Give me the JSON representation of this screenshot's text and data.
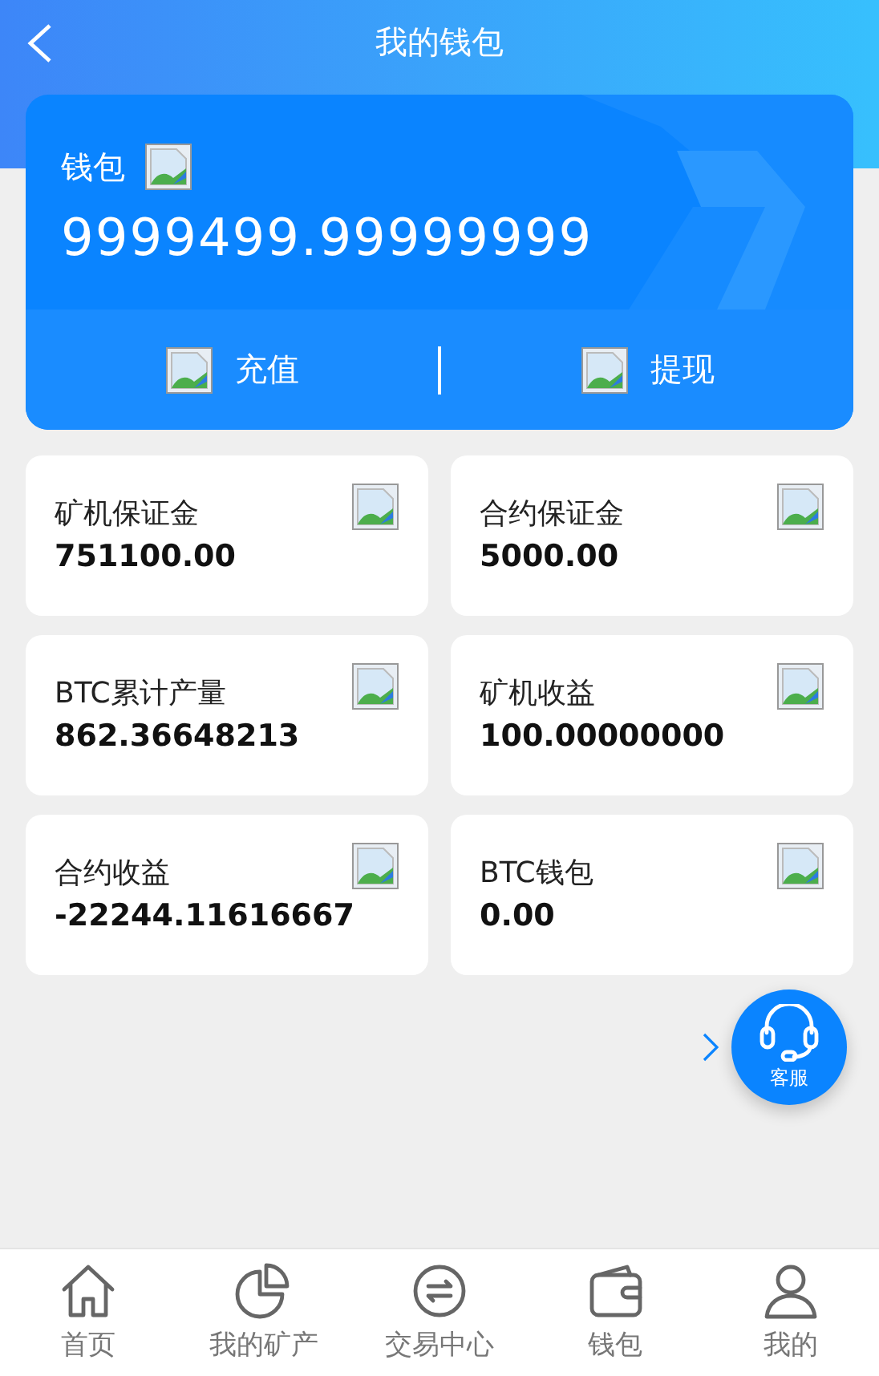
{
  "header": {
    "title": "我的钱包"
  },
  "wallet": {
    "label": "钱包",
    "balance": "9999499.99999999",
    "actions": [
      {
        "label": "充值"
      },
      {
        "label": "提现"
      }
    ]
  },
  "stats": [
    {
      "label": "矿机保证金",
      "value": "751100.00"
    },
    {
      "label": "合约保证金",
      "value": "5000.00"
    },
    {
      "label": "BTC累计产量",
      "value": "862.36648213"
    },
    {
      "label": "矿机收益",
      "value": "100.00000000"
    },
    {
      "label": "合约收益",
      "value": "-22244.11616667"
    },
    {
      "label": "BTC钱包",
      "value": "0.00"
    }
  ],
  "support": {
    "label": "客服"
  },
  "tabbar": [
    {
      "label": "首页",
      "kind": "home",
      "selected": false
    },
    {
      "label": "我的矿产",
      "kind": "pie",
      "selected": false
    },
    {
      "label": "交易中心",
      "kind": "exchange",
      "selected": false
    },
    {
      "label": "钱包",
      "kind": "wallet",
      "selected": false
    },
    {
      "label": "我的",
      "kind": "user",
      "selected": false
    }
  ]
}
